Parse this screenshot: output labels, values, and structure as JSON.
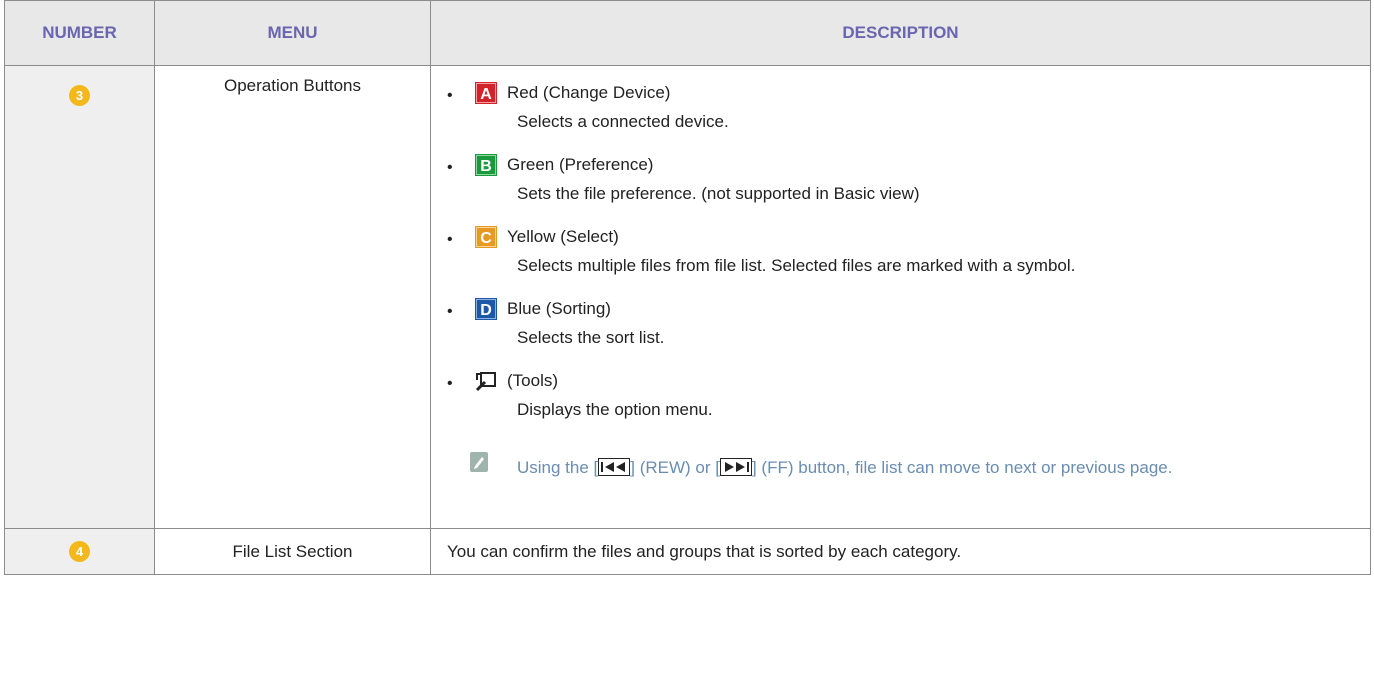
{
  "table": {
    "headers": {
      "number": "NUMBER",
      "menu": "MENU",
      "description": "DESCRIPTION"
    },
    "rows": [
      {
        "number": "3",
        "menu": "Operation Buttons",
        "items": [
          {
            "icon": "red-a-key-icon",
            "color": "#d2232a",
            "title": "Red (Change Device)",
            "desc": "Selects a connected device."
          },
          {
            "icon": "green-b-key-icon",
            "color": "#1a9a3c",
            "title": "Green (Preference)",
            "desc": "Sets the file preference. (not supported in Basic view)"
          },
          {
            "icon": "yellow-c-key-icon",
            "color": "#e69a24",
            "title": "Yellow (Select)",
            "desc": "Selects multiple files from file list. Selected files are marked with a symbol."
          },
          {
            "icon": "blue-d-key-icon",
            "color": "#1b59a8",
            "title": "Blue (Sorting)",
            "desc": "Selects the sort list."
          },
          {
            "icon": "tools-key-icon",
            "color": "#222222",
            "title": "(Tools)",
            "desc": "Displays the option menu."
          }
        ],
        "note": {
          "part1": "Using the [",
          "part2": "] (REW) or [",
          "part3": "] (FF) button, file list can move to next or previous page."
        }
      },
      {
        "number": "4",
        "menu": "File List Section",
        "description": "You can confirm the files and groups that is sorted by each category."
      }
    ]
  },
  "colors": {
    "header_text": "#6a65b0",
    "header_bg": "#e8e8e8",
    "badge": "#f5b81c",
    "note_text": "#6a8db0"
  }
}
